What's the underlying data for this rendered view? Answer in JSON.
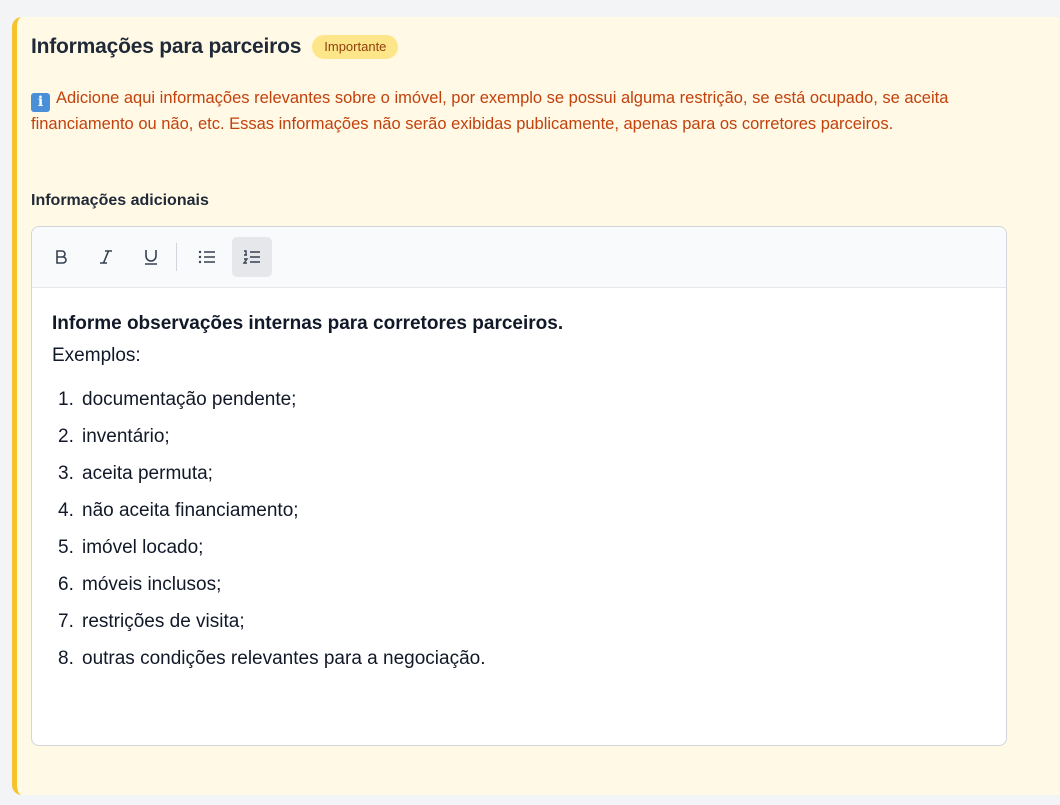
{
  "section": {
    "title": "Informações para parceiros",
    "badge": "Importante",
    "info_icon": "info-icon",
    "info_text": "Adicione aqui informações relevantes sobre o imóvel, por exemplo se possui alguma restrição, se está ocupado, se aceita financiamento ou não, etc. Essas informações não serão exibidas publicamente, apenas para os corretores parceiros."
  },
  "field": {
    "label": "Informações adicionais"
  },
  "toolbar": {
    "bold_icon": "B",
    "italic_icon": "I",
    "underline_icon": "U",
    "bullet_list": "bullet-list-icon",
    "ordered_list": "ordered-list-icon",
    "active": "ordered-list"
  },
  "editor": {
    "heading": "Informe observações internas para corretores parceiros.",
    "intro": "Exemplos:",
    "items": [
      {
        "num": "1.",
        "text": "documentação pendente;"
      },
      {
        "num": "2.",
        "text": "inventário;"
      },
      {
        "num": "3.",
        "text": "aceita permuta;"
      },
      {
        "num": "4.",
        "text": "não aceita financiamento;"
      },
      {
        "num": "5.",
        "text": "imóvel locado;"
      },
      {
        "num": "6.",
        "text": "móveis inclusos;"
      },
      {
        "num": "7.",
        "text": "restrições de visita;"
      },
      {
        "num": "8.",
        "text": "outras condições relevantes para a negociação."
      }
    ]
  },
  "colors": {
    "card_bg": "#fff9e6",
    "accent_border": "#f5c32c",
    "badge_bg": "#fde68a",
    "badge_text": "#92400e",
    "info_text": "#c2410c"
  }
}
